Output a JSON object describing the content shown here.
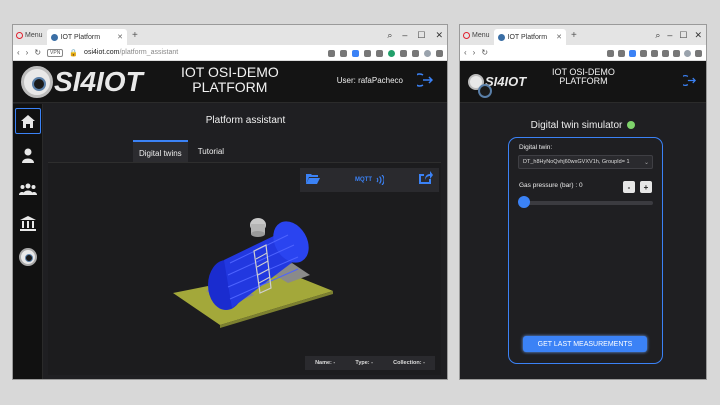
{
  "browser": {
    "menu_label": "Menu",
    "tab_title": "IOT Platform",
    "vpn_label": "VPN",
    "url_domain": "osi4iot.com",
    "url_path": "/platform_assistant"
  },
  "app": {
    "logo_text": "SI4IOT",
    "title_line1": "IOT OSI-DEMO",
    "title_line2": "PLATFORM",
    "user_label": "User: rafaPacheco"
  },
  "assistant": {
    "page_title": "Platform assistant",
    "tabs": [
      {
        "label": "Digital twins",
        "active": true
      },
      {
        "label": "Tutorial",
        "active": false
      }
    ],
    "toolbar": {
      "mqtt_label": "MQTT"
    },
    "status": {
      "name": "Name: -",
      "type": "Type: -",
      "collection": "Collection: -"
    }
  },
  "simulator": {
    "title": "Digital twin simulator",
    "status_color": "#7ed36b",
    "digital_twin_label": "Digital twin:",
    "digital_twin_value": "DT_h8HyNoQvhj60wxGVXV1h, GroupId= 1",
    "gas_pressure_label": "Gas pressure (bar) : 0",
    "gas_pressure_value": 0,
    "minus_label": "-",
    "plus_label": "+",
    "get_button_label": "GET LAST MEASUREMENTS"
  },
  "colors": {
    "accent": "#3b82f6",
    "background": "#1f1f22"
  }
}
